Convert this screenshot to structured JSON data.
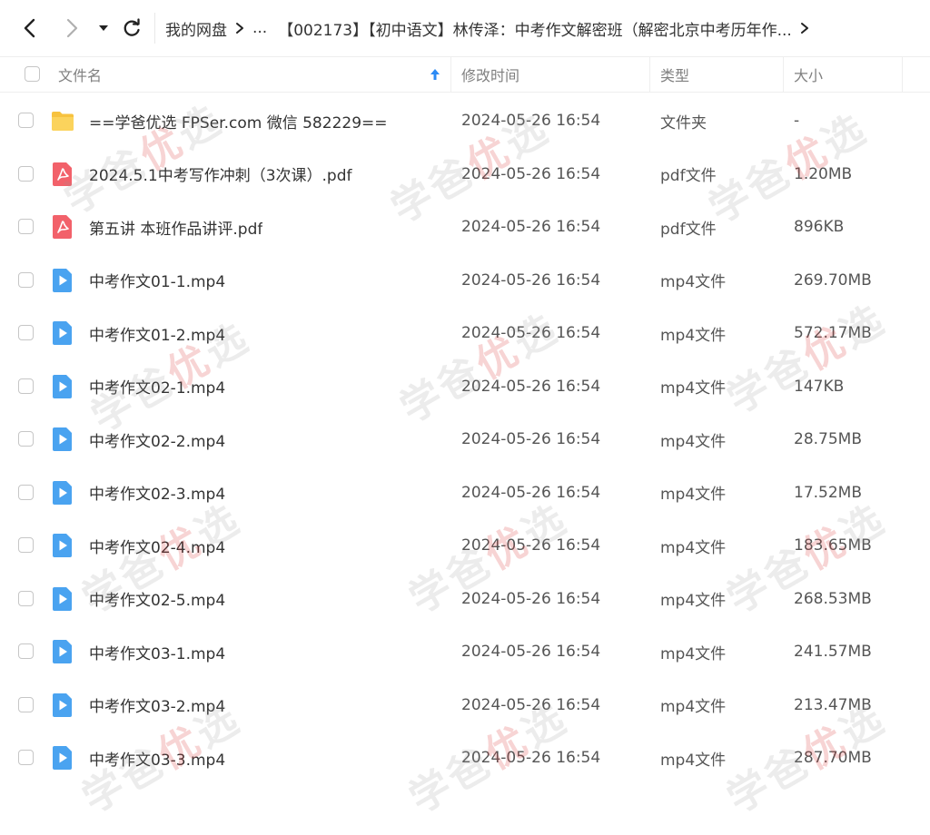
{
  "nav": {
    "breadcrumb": {
      "root": "我的网盘",
      "ellipsis": "...",
      "current": "【002173】【初中语文】林传泽：中考作文解密班（解密北京中考历年作..."
    }
  },
  "table": {
    "headers": {
      "name": "文件名",
      "modified": "修改时间",
      "type": "类型",
      "size": "大小"
    },
    "sort_column": "name",
    "sort_direction": "ascending",
    "rows": [
      {
        "name": "==学爸优选 FPSer.com 微信 582229==",
        "modified": "2024-05-26 16:54",
        "type": "文件夹",
        "size": "-",
        "icon": "folder-icon"
      },
      {
        "name": "2024.5.1中考写作冲刺（3次课）.pdf",
        "modified": "2024-05-26 16:54",
        "type": "pdf文件",
        "size": "1.20MB",
        "icon": "pdf-icon"
      },
      {
        "name": "第五讲  本班作品讲评.pdf",
        "modified": "2024-05-26 16:54",
        "type": "pdf文件",
        "size": "896KB",
        "icon": "pdf-icon"
      },
      {
        "name": "中考作文01-1.mp4",
        "modified": "2024-05-26 16:54",
        "type": "mp4文件",
        "size": "269.70MB",
        "icon": "video-icon"
      },
      {
        "name": "中考作文01-2.mp4",
        "modified": "2024-05-26 16:54",
        "type": "mp4文件",
        "size": "572.17MB",
        "icon": "video-icon"
      },
      {
        "name": "中考作文02-1.mp4",
        "modified": "2024-05-26 16:54",
        "type": "mp4文件",
        "size": "147KB",
        "icon": "video-icon"
      },
      {
        "name": "中考作文02-2.mp4",
        "modified": "2024-05-26 16:54",
        "type": "mp4文件",
        "size": "28.75MB",
        "icon": "video-icon"
      },
      {
        "name": "中考作文02-3.mp4",
        "modified": "2024-05-26 16:54",
        "type": "mp4文件",
        "size": "17.52MB",
        "icon": "video-icon"
      },
      {
        "name": "中考作文02-4.mp4",
        "modified": "2024-05-26 16:54",
        "type": "mp4文件",
        "size": "183.65MB",
        "icon": "video-icon"
      },
      {
        "name": "中考作文02-5.mp4",
        "modified": "2024-05-26 16:54",
        "type": "mp4文件",
        "size": "268.53MB",
        "icon": "video-icon"
      },
      {
        "name": "中考作文03-1.mp4",
        "modified": "2024-05-26 16:54",
        "type": "mp4文件",
        "size": "241.57MB",
        "icon": "video-icon"
      },
      {
        "name": "中考作文03-2.mp4",
        "modified": "2024-05-26 16:54",
        "type": "mp4文件",
        "size": "213.47MB",
        "icon": "video-icon"
      },
      {
        "name": "中考作文03-3.mp4",
        "modified": "2024-05-26 16:54",
        "type": "mp4文件",
        "size": "287.70MB",
        "icon": "video-icon"
      }
    ]
  },
  "watermark": {
    "part1": "学爸",
    "part2": "优",
    "part3": "选"
  },
  "colors": {
    "accent": "#2b8af5",
    "folder": "#f7c23e",
    "pdf": "#f2616a",
    "video": "#4aa3f0"
  }
}
